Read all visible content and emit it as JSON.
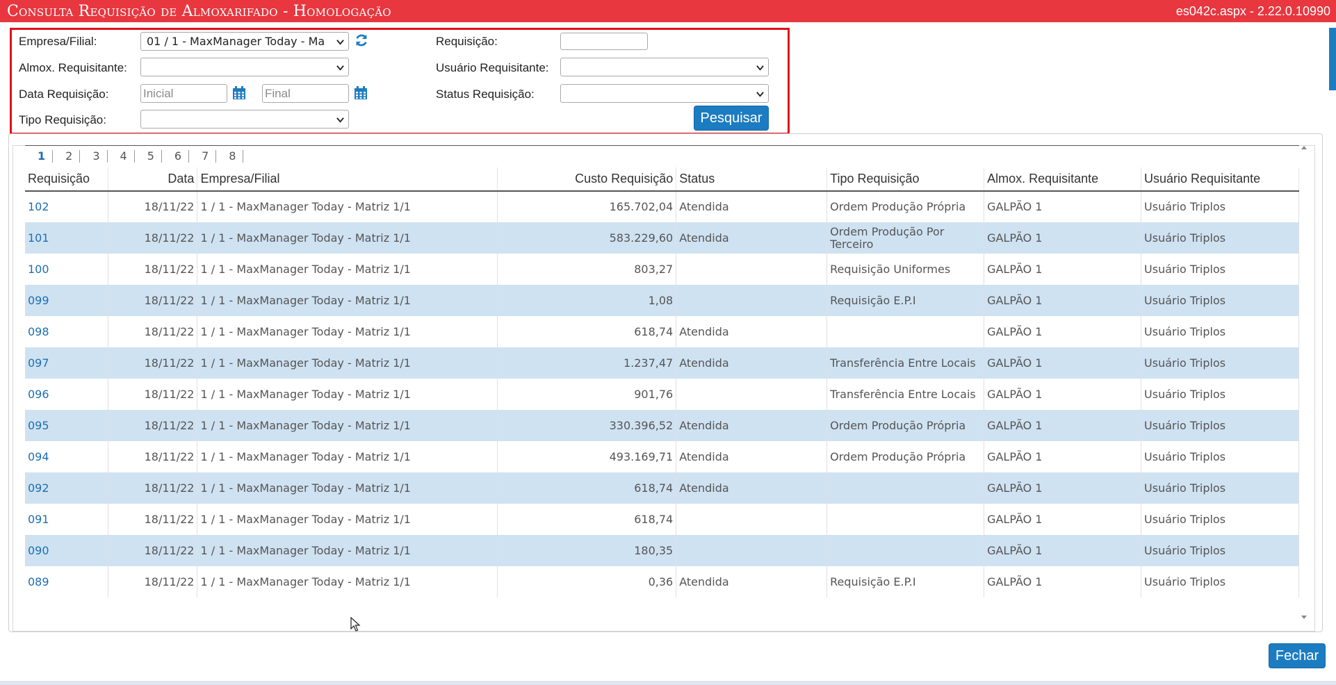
{
  "titlebar": {
    "title": "Consulta Requisição de Almoxarifado  - Homologação",
    "version": "es042c.aspx - 2.22.0.10990"
  },
  "filters": {
    "empresa_label": "Empresa/Filial:",
    "empresa_value": "01 / 1 - MaxManager Today - Ma",
    "almox_label": "Almox. Requisitante:",
    "almox_value": "",
    "data_label": "Data Requisição:",
    "data_inicial_placeholder": "Inicial",
    "data_final_placeholder": "Final",
    "tipo_label": "Tipo Requisição:",
    "tipo_value": "",
    "requisicao_label": "Requisição:",
    "requisicao_value": "",
    "usuario_label": "Usuário Requisitante:",
    "usuario_value": "",
    "status_label": "Status Requisição:",
    "status_value": "",
    "search_button": "Pesquisar"
  },
  "pager": [
    "1",
    "2",
    "3",
    "4",
    "5",
    "6",
    "7",
    "8"
  ],
  "pager_current": "1",
  "table": {
    "headers": [
      "Requisição",
      "Data",
      "Empresa/Filial",
      "Custo Requisição",
      "Status",
      "Tipo Requisição",
      "Almox. Requisitante",
      "Usuário Requisitante"
    ],
    "rows": [
      [
        "102",
        "18/11/22",
        "1 / 1 - MaxManager Today - Matriz 1/1",
        "165.702,04",
        "Atendida",
        "Ordem Produção Própria",
        "GALPÃO 1",
        "Usuário Triplos"
      ],
      [
        "101",
        "18/11/22",
        "1 / 1 - MaxManager Today - Matriz 1/1",
        "583.229,60",
        "Atendida",
        "Ordem Produção Por Terceiro",
        "GALPÃO 1",
        "Usuário Triplos"
      ],
      [
        "100",
        "18/11/22",
        "1 / 1 - MaxManager Today - Matriz 1/1",
        "803,27",
        "",
        "Requisição Uniformes",
        "GALPÃO 1",
        "Usuário Triplos"
      ],
      [
        "099",
        "18/11/22",
        "1 / 1 - MaxManager Today - Matriz 1/1",
        "1,08",
        "",
        "Requisição E.P.I",
        "GALPÃO 1",
        "Usuário Triplos"
      ],
      [
        "098",
        "18/11/22",
        "1 / 1 - MaxManager Today - Matriz 1/1",
        "618,74",
        "Atendida",
        "",
        "GALPÃO 1",
        "Usuário Triplos"
      ],
      [
        "097",
        "18/11/22",
        "1 / 1 - MaxManager Today - Matriz 1/1",
        "1.237,47",
        "Atendida",
        "Transferência Entre Locais",
        "GALPÃO 1",
        "Usuário Triplos"
      ],
      [
        "096",
        "18/11/22",
        "1 / 1 - MaxManager Today - Matriz 1/1",
        "901,76",
        "",
        "Transferência Entre Locais",
        "GALPÃO 1",
        "Usuário Triplos"
      ],
      [
        "095",
        "18/11/22",
        "1 / 1 - MaxManager Today - Matriz 1/1",
        "330.396,52",
        "Atendida",
        "Ordem Produção Própria",
        "GALPÃO 1",
        "Usuário Triplos"
      ],
      [
        "094",
        "18/11/22",
        "1 / 1 - MaxManager Today - Matriz 1/1",
        "493.169,71",
        "Atendida",
        "Ordem Produção Própria",
        "GALPÃO 1",
        "Usuário Triplos"
      ],
      [
        "092",
        "18/11/22",
        "1 / 1 - MaxManager Today - Matriz 1/1",
        "618,74",
        "Atendida",
        "",
        "GALPÃO 1",
        "Usuário Triplos"
      ],
      [
        "091",
        "18/11/22",
        "1 / 1 - MaxManager Today - Matriz 1/1",
        "618,74",
        "",
        "",
        "GALPÃO 1",
        "Usuário Triplos"
      ],
      [
        "090",
        "18/11/22",
        "1 / 1 - MaxManager Today - Matriz 1/1",
        "180,35",
        "",
        "",
        "GALPÃO 1",
        "Usuário Triplos"
      ],
      [
        "089",
        "18/11/22",
        "1 / 1 - MaxManager Today - Matriz 1/1",
        "0,36",
        "Atendida",
        "Requisição E.P.I",
        "GALPÃO 1",
        "Usuário Triplos"
      ]
    ]
  },
  "close_button": "Fechar",
  "colors": {
    "title_bar": "#e8373f",
    "accent": "#1c7cc1",
    "row_alt": "#cfe2f2",
    "filter_border": "#e0101b"
  },
  "icons": {
    "refresh": "refresh-icon",
    "calendar": "calendar-icon",
    "dropdown": "chevron-down-icon"
  }
}
